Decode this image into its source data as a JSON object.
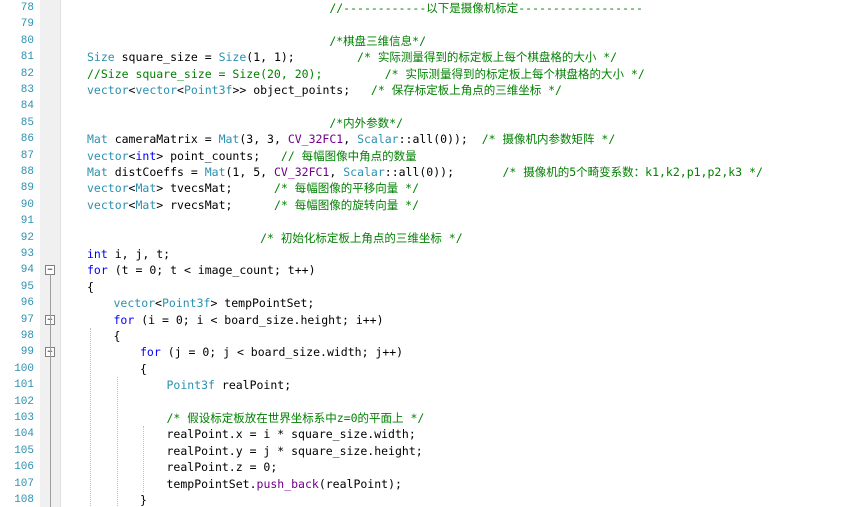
{
  "lines": [
    {
      "n": "78",
      "indent": 0,
      "tokens": [
        {
          "t": "                                   //------------以下是摄像机标定------------------",
          "c": "cm"
        }
      ]
    },
    {
      "n": "79",
      "indent": 0,
      "tokens": []
    },
    {
      "n": "80",
      "indent": 0,
      "tokens": [
        {
          "t": "                                   /*棋盘三维信息*/",
          "c": "cm"
        }
      ]
    },
    {
      "n": "81",
      "indent": 0,
      "tokens": [
        {
          "t": "Size",
          "c": "ty"
        },
        {
          "t": " square_size = ",
          "c": "pl"
        },
        {
          "t": "Size",
          "c": "ty"
        },
        {
          "t": "(1, 1);         ",
          "c": "pl"
        },
        {
          "t": "/* 实际测量得到的标定板上每个棋盘格的大小 */",
          "c": "cm"
        }
      ]
    },
    {
      "n": "82",
      "indent": 0,
      "tokens": [
        {
          "t": "//Size square_size = Size(20, 20);         /* 实际测量得到的标定板上每个棋盘格的大小 */",
          "c": "cm"
        }
      ]
    },
    {
      "n": "83",
      "indent": 0,
      "tokens": [
        {
          "t": "vector",
          "c": "ty"
        },
        {
          "t": "<",
          "c": "pl"
        },
        {
          "t": "vector",
          "c": "ty"
        },
        {
          "t": "<",
          "c": "pl"
        },
        {
          "t": "Point3f",
          "c": "ty"
        },
        {
          "t": ">> object_points;   ",
          "c": "pl"
        },
        {
          "t": "/* 保存标定板上角点的三维坐标 */",
          "c": "cm"
        }
      ]
    },
    {
      "n": "84",
      "indent": 0,
      "tokens": []
    },
    {
      "n": "85",
      "indent": 0,
      "tokens": [
        {
          "t": "                                   /*内外参数*/",
          "c": "cm"
        }
      ]
    },
    {
      "n": "86",
      "indent": 0,
      "tokens": [
        {
          "t": "Mat",
          "c": "ty"
        },
        {
          "t": " cameraMatrix = ",
          "c": "pl"
        },
        {
          "t": "Mat",
          "c": "ty"
        },
        {
          "t": "(3, 3, ",
          "c": "pl"
        },
        {
          "t": "CV_32FC1",
          "c": "mc"
        },
        {
          "t": ", ",
          "c": "pl"
        },
        {
          "t": "Scalar",
          "c": "ty"
        },
        {
          "t": "::all(0));  ",
          "c": "pl"
        },
        {
          "t": "/* 摄像机内参数矩阵 */",
          "c": "cm"
        }
      ]
    },
    {
      "n": "87",
      "indent": 0,
      "tokens": [
        {
          "t": "vector",
          "c": "ty"
        },
        {
          "t": "<",
          "c": "pl"
        },
        {
          "t": "int",
          "c": "kw"
        },
        {
          "t": "> point_counts;   ",
          "c": "pl"
        },
        {
          "t": "// 每幅图像中角点的数量",
          "c": "cm"
        }
      ]
    },
    {
      "n": "88",
      "indent": 0,
      "tokens": [
        {
          "t": "Mat",
          "c": "ty"
        },
        {
          "t": " distCoeffs = ",
          "c": "pl"
        },
        {
          "t": "Mat",
          "c": "ty"
        },
        {
          "t": "(1, 5, ",
          "c": "pl"
        },
        {
          "t": "CV_32FC1",
          "c": "mc"
        },
        {
          "t": ", ",
          "c": "pl"
        },
        {
          "t": "Scalar",
          "c": "ty"
        },
        {
          "t": "::all(0));       ",
          "c": "pl"
        },
        {
          "t": "/* 摄像机的5个畸变系数：k1,k2,p1,p2,k3 */",
          "c": "cm"
        }
      ]
    },
    {
      "n": "89",
      "indent": 0,
      "tokens": [
        {
          "t": "vector",
          "c": "ty"
        },
        {
          "t": "<",
          "c": "pl"
        },
        {
          "t": "Mat",
          "c": "ty"
        },
        {
          "t": "> tvecsMat;      ",
          "c": "pl"
        },
        {
          "t": "/* 每幅图像的平移向量 */",
          "c": "cm"
        }
      ]
    },
    {
      "n": "90",
      "indent": 0,
      "tokens": [
        {
          "t": "vector",
          "c": "ty"
        },
        {
          "t": "<",
          "c": "pl"
        },
        {
          "t": "Mat",
          "c": "ty"
        },
        {
          "t": "> rvecsMat;      ",
          "c": "pl"
        },
        {
          "t": "/* 每幅图像的旋转向量 */",
          "c": "cm"
        }
      ]
    },
    {
      "n": "91",
      "indent": 0,
      "tokens": []
    },
    {
      "n": "92",
      "indent": 0,
      "tokens": [
        {
          "t": "                         /* 初始化标定板上角点的三维坐标 */",
          "c": "cm"
        }
      ]
    },
    {
      "n": "93",
      "indent": 0,
      "tokens": [
        {
          "t": "int",
          "c": "kw"
        },
        {
          "t": " i, j, t;",
          "c": "pl"
        }
      ]
    },
    {
      "n": "94",
      "indent": 0,
      "fold": true,
      "tokens": [
        {
          "t": "for",
          "c": "kw"
        },
        {
          "t": " (t = 0; t < image_count; t++)",
          "c": "pl"
        }
      ]
    },
    {
      "n": "95",
      "indent": 0,
      "tokens": [
        {
          "t": "{",
          "c": "pl"
        }
      ]
    },
    {
      "n": "96",
      "indent": 1,
      "tokens": [
        {
          "t": "vector",
          "c": "ty"
        },
        {
          "t": "<",
          "c": "pl"
        },
        {
          "t": "Point3f",
          "c": "ty"
        },
        {
          "t": "> tempPointSet;",
          "c": "pl"
        }
      ]
    },
    {
      "n": "97",
      "indent": 1,
      "fold": true,
      "tokens": [
        {
          "t": "for",
          "c": "kw"
        },
        {
          "t": " (i = 0; i < board_size.height; i++)",
          "c": "pl"
        }
      ]
    },
    {
      "n": "98",
      "indent": 1,
      "tokens": [
        {
          "t": "{",
          "c": "pl"
        }
      ]
    },
    {
      "n": "99",
      "indent": 2,
      "fold": true,
      "tokens": [
        {
          "t": "for",
          "c": "kw"
        },
        {
          "t": " (j = 0; j < board_size.width; j++)",
          "c": "pl"
        }
      ]
    },
    {
      "n": "100",
      "indent": 2,
      "tokens": [
        {
          "t": "{",
          "c": "pl"
        }
      ]
    },
    {
      "n": "101",
      "indent": 3,
      "tokens": [
        {
          "t": "Point3f",
          "c": "ty"
        },
        {
          "t": " realPoint;",
          "c": "pl"
        }
      ]
    },
    {
      "n": "102",
      "indent": 3,
      "tokens": []
    },
    {
      "n": "103",
      "indent": 3,
      "tokens": [
        {
          "t": "/* 假设标定板放在世界坐标系中z=0的平面上 */",
          "c": "cm"
        }
      ]
    },
    {
      "n": "104",
      "indent": 3,
      "tokens": [
        {
          "t": "realPoint.x = i * square_size.width;",
          "c": "pl"
        }
      ]
    },
    {
      "n": "105",
      "indent": 3,
      "tokens": [
        {
          "t": "realPoint.y = j * square_size.height;",
          "c": "pl"
        }
      ]
    },
    {
      "n": "106",
      "indent": 3,
      "tokens": [
        {
          "t": "realPoint.z = 0;",
          "c": "pl"
        }
      ]
    },
    {
      "n": "107",
      "indent": 3,
      "tokens": [
        {
          "t": "tempPointSet.",
          "c": "pl"
        },
        {
          "t": "push_back",
          "c": "mc"
        },
        {
          "t": "(realPoint);",
          "c": "pl"
        }
      ]
    },
    {
      "n": "108",
      "indent": 2,
      "tokens": [
        {
          "t": "}",
          "c": "pl"
        }
      ]
    }
  ],
  "fold_glyph": "−"
}
